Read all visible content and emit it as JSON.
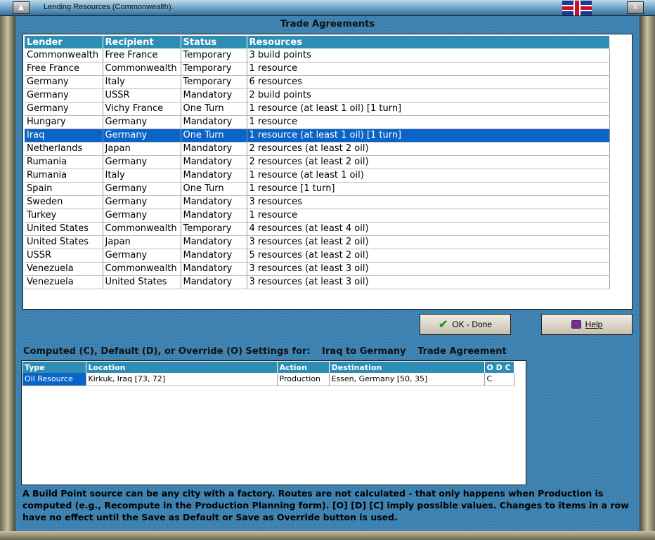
{
  "window": {
    "title": "Lending Resources (Commonwealth)."
  },
  "section_title": "Trade Agreements",
  "agreements": {
    "columns": [
      "Lender",
      "Recipient",
      "Status",
      "Resources"
    ],
    "rows": [
      [
        "Commonwealth",
        "Free France",
        "Temporary",
        "3 build points"
      ],
      [
        "Free France",
        "Commonwealth",
        "Temporary",
        "1 resource"
      ],
      [
        "Germany",
        "Italy",
        "Temporary",
        "6 resources"
      ],
      [
        "Germany",
        "USSR",
        "Mandatory",
        "2 build points"
      ],
      [
        "Germany",
        "Vichy France",
        "One Turn",
        "1 resource (at least 1 oil) [1 turn]"
      ],
      [
        "Hungary",
        "Germany",
        "Mandatory",
        "1 resource"
      ],
      [
        "Iraq",
        "Germany",
        "One Turn",
        "1 resource (at least 1 oil) [1 turn]"
      ],
      [
        "Netherlands",
        "Japan",
        "Mandatory",
        "2 resources (at least 2 oil)"
      ],
      [
        "Rumania",
        "Germany",
        "Mandatory",
        "2 resources (at least 2 oil)"
      ],
      [
        "Rumania",
        "Italy",
        "Mandatory",
        "1 resource (at least 1 oil)"
      ],
      [
        "Spain",
        "Germany",
        "One Turn",
        "1 resource [1 turn]"
      ],
      [
        "Sweden",
        "Germany",
        "Mandatory",
        "3 resources"
      ],
      [
        "Turkey",
        "Germany",
        "Mandatory",
        "1 resource"
      ],
      [
        "United States",
        "Commonwealth",
        "Temporary",
        "4 resources (at least 4 oil)"
      ],
      [
        "United States",
        "Japan",
        "Mandatory",
        "3 resources (at least 2 oil)"
      ],
      [
        "USSR",
        "Germany",
        "Mandatory",
        "5 resources (at least 2 oil)"
      ],
      [
        "Venezuela",
        "Commonwealth",
        "Mandatory",
        "3 resources (at least 3 oil)"
      ],
      [
        "Venezuela",
        "United States",
        "Mandatory",
        "3 resources (at least 3 oil)"
      ]
    ],
    "selected_index": 6
  },
  "buttons": {
    "ok": "OK - Done",
    "help": "Help"
  },
  "settings": {
    "label": "Computed (C), Default (D), or Override (O) Settings for:",
    "pair": "Iraq to Germany",
    "kind": "Trade Agreement",
    "columns": [
      "Type",
      "Location",
      "Action",
      "Destination",
      "O D C"
    ],
    "rows": [
      [
        "Oil Resource",
        "Kirkuk, Iraq [73, 72]",
        "Production",
        "Essen, Germany [50, 35]",
        "C"
      ]
    ]
  },
  "footer": "A Build Point source can be any city with a factory. Routes are not calculated - that only happens when Production is computed (e.g., Recompute in the Production Planning form).  [O] [D] [C] imply possible values.  Changes to items in a row have no effect until the Save as Default or Save as Override button is used."
}
